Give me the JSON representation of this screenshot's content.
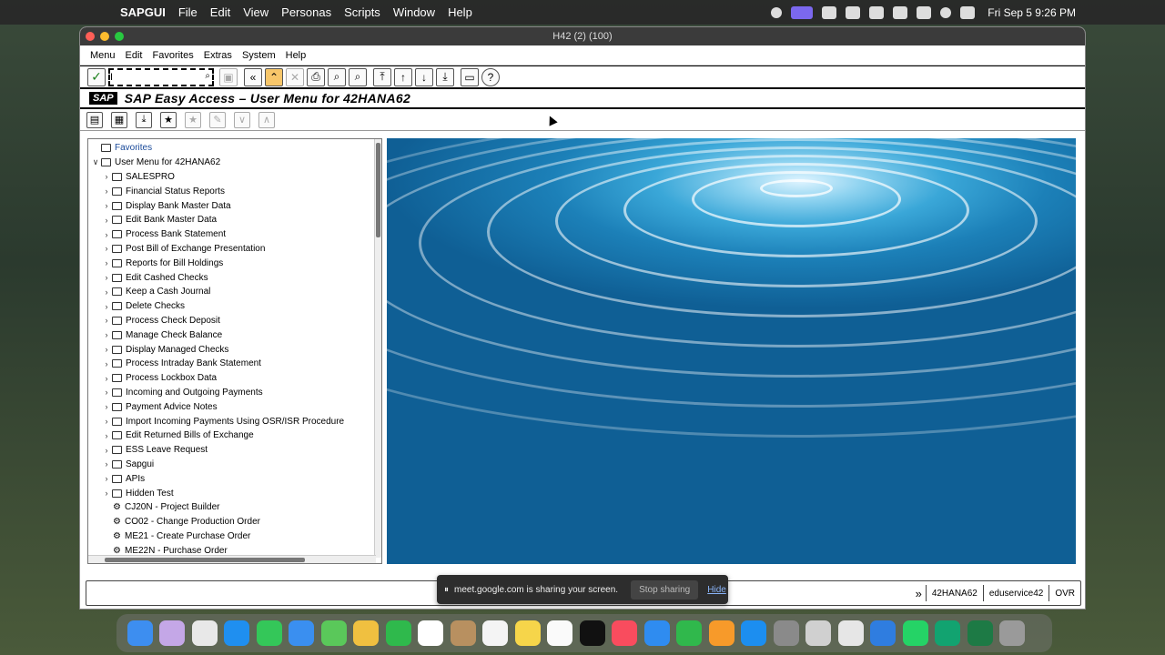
{
  "mac_menubar": {
    "apple_glyph": "",
    "app_name": "SAPGUI",
    "items": [
      "File",
      "Edit",
      "View",
      "Personas",
      "Scripts",
      "Window",
      "Help"
    ],
    "clock": "Fri Sep 5  9:26 PM"
  },
  "window": {
    "title": "H42 (2) (100)"
  },
  "sap_menu": {
    "items": [
      "Menu",
      "Edit",
      "Favorites",
      "Extras",
      "System",
      "Help"
    ]
  },
  "command_field": {
    "value": "I",
    "enter_symbol": "✓",
    "history_symbol": "⌕"
  },
  "toolbar_glyphs": {
    "save": "▣",
    "back": "«",
    "exit": "⌃",
    "cancel": "✕",
    "print": "⎙",
    "find": "⌕",
    "find_next": "⌕",
    "first_page": "⤒",
    "prev_page": "↑",
    "next_page": "↓",
    "last_page": "⤓",
    "new_session": "▭",
    "help": "?"
  },
  "app_title": {
    "logo": "SAP",
    "text": "SAP Easy Access  –  User Menu for 42HANA62"
  },
  "app_toolbar_glyphs": {
    "user_menu": "▤",
    "sap_menu": "▦",
    "other_menu": "⤓",
    "add_favorite": "★",
    "delete_favorite": "★",
    "change_favorite": "✎",
    "move_down": "∨",
    "move_up": "∧"
  },
  "tree": {
    "favorites": "Favorites",
    "root": "User Menu for 42HANA62",
    "folders": [
      "SALESPRO",
      "Financial Status Reports",
      "Display Bank Master Data",
      "Edit Bank Master Data",
      "Process Bank Statement",
      "Post Bill of Exchange Presentation",
      "Reports for Bill Holdings",
      "Edit Cashed Checks",
      "Keep a Cash Journal",
      "Delete Checks",
      "Process Check Deposit",
      "Manage Check Balance",
      "Display Managed Checks",
      "Process Intraday Bank Statement",
      "Process Lockbox Data",
      "Incoming and Outgoing Payments",
      "Payment Advice Notes",
      "Import Incoming Payments Using OSR/ISR Procedure",
      "Edit Returned Bills of Exchange",
      "ESS Leave Request",
      "Sapgui",
      "APIs",
      "Hidden Test"
    ],
    "transactions": [
      "CJ20N - Project Builder",
      "CO02 - Change Production Order",
      "ME21 - Create Purchase Order",
      "ME22N - Purchase Order"
    ],
    "expanded_arrow": "∨",
    "collapsed_arrow": "›",
    "transaction_glyph": "⚙"
  },
  "status_bar": {
    "expand_glyph": "»",
    "system": "42HANA62",
    "server": "eduservice42",
    "mode": "OVR"
  },
  "screen_share": {
    "pause_glyph": "⏸",
    "message": "meet.google.com is sharing your screen.",
    "stop_label": "Stop sharing",
    "hide_label": "Hide"
  },
  "dock": {
    "apps": [
      {
        "name": "finder-icon",
        "color": "#3d8ef0"
      },
      {
        "name": "launchpad-icon",
        "color": "#c4a7e7"
      },
      {
        "name": "chrome-icon",
        "color": "#e8e8e8"
      },
      {
        "name": "safari-icon",
        "color": "#1f8ff0"
      },
      {
        "name": "messages-icon",
        "color": "#34c759"
      },
      {
        "name": "mail-icon",
        "color": "#3a8ff0"
      },
      {
        "name": "maps-icon",
        "color": "#5ac85a"
      },
      {
        "name": "photos-icon",
        "color": "#f0c040"
      },
      {
        "name": "facetime-icon",
        "color": "#2fb94c"
      },
      {
        "name": "calendar-icon",
        "color": "#ffffff"
      },
      {
        "name": "contacts-icon",
        "color": "#b89060"
      },
      {
        "name": "reminders-icon",
        "color": "#f4f4f4"
      },
      {
        "name": "notes-icon",
        "color": "#f6d54a"
      },
      {
        "name": "freeform-icon",
        "color": "#fafafa"
      },
      {
        "name": "tv-icon",
        "color": "#111111"
      },
      {
        "name": "music-icon",
        "color": "#f94c5e"
      },
      {
        "name": "keynote-icon",
        "color": "#2f8cf0"
      },
      {
        "name": "numbers-icon",
        "color": "#30b84c"
      },
      {
        "name": "pages-icon",
        "color": "#f79a2a"
      },
      {
        "name": "appstore-icon",
        "color": "#1c8ef0"
      },
      {
        "name": "settings-icon",
        "color": "#8a8a8a"
      },
      {
        "name": "iphone-mirroring-icon",
        "color": "#d0d0d0"
      },
      {
        "name": "sapgui-icon",
        "color": "#e6e6e6"
      },
      {
        "name": "windows-app-icon",
        "color": "#2f7de0"
      },
      {
        "name": "whatsapp-icon",
        "color": "#25d366"
      },
      {
        "name": "zoom-icon",
        "color": "#12a370"
      },
      {
        "name": "excel-icon",
        "color": "#1d7a45"
      },
      {
        "name": "trash-icon",
        "color": "#9a9a9a"
      }
    ]
  }
}
